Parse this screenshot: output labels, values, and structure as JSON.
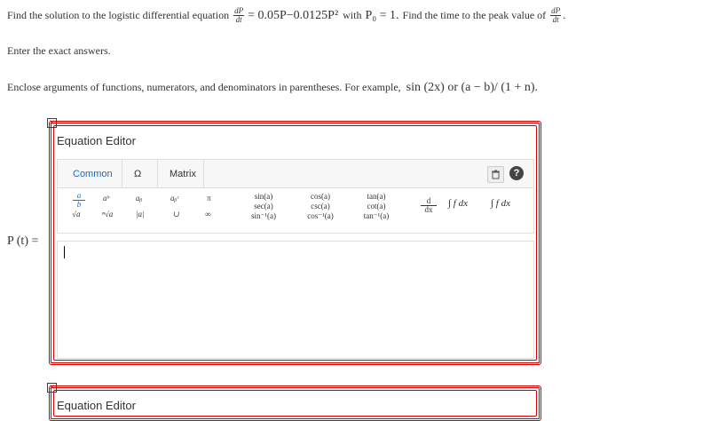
{
  "question": {
    "prefix": "Find the solution to the logistic differential equation",
    "deriv_num": "dP",
    "deriv_den": "dt",
    "rhs": "= 0.05P−0.0125P²",
    "with": "with",
    "initial": "P₀ = 1.",
    "second": "Find the time to the peak value of",
    "period": "."
  },
  "instruction1": "Enter the exact answers.",
  "instruction2": "Enclose arguments of functions, numerators, and denominators in parentheses. For example,",
  "instruction2_example": "sin (2x) or (a − b)/ (1 + n).",
  "answer_label": "P (t) =",
  "editor": {
    "title": "Equation Editor",
    "tabs": [
      "Common",
      "Ω",
      "Matrix"
    ],
    "second_title": "Equation Editor",
    "close": "×"
  },
  "palette": {
    "frac": [
      "a",
      "b"
    ],
    "power": "aᵇ",
    "sub": "aᵦ",
    "subsup": "aᵦᶜ",
    "pi": "π",
    "sqrt": "√a",
    "nroot": "ⁿ√a",
    "abs": "|a|",
    "union": "∪",
    "inf": "∞",
    "trig1": [
      "sin(a)",
      "sec(a)",
      "sin⁻¹(a)"
    ],
    "trig2": [
      "cos(a)",
      "csc(a)",
      "cos⁻¹(a)"
    ],
    "trig3": [
      "tan(a)",
      "cot(a)",
      "tan⁻¹(a)"
    ],
    "deriv": [
      "d",
      "dx"
    ],
    "integral": "∫ f dx",
    "defint": "∫ f dx"
  }
}
